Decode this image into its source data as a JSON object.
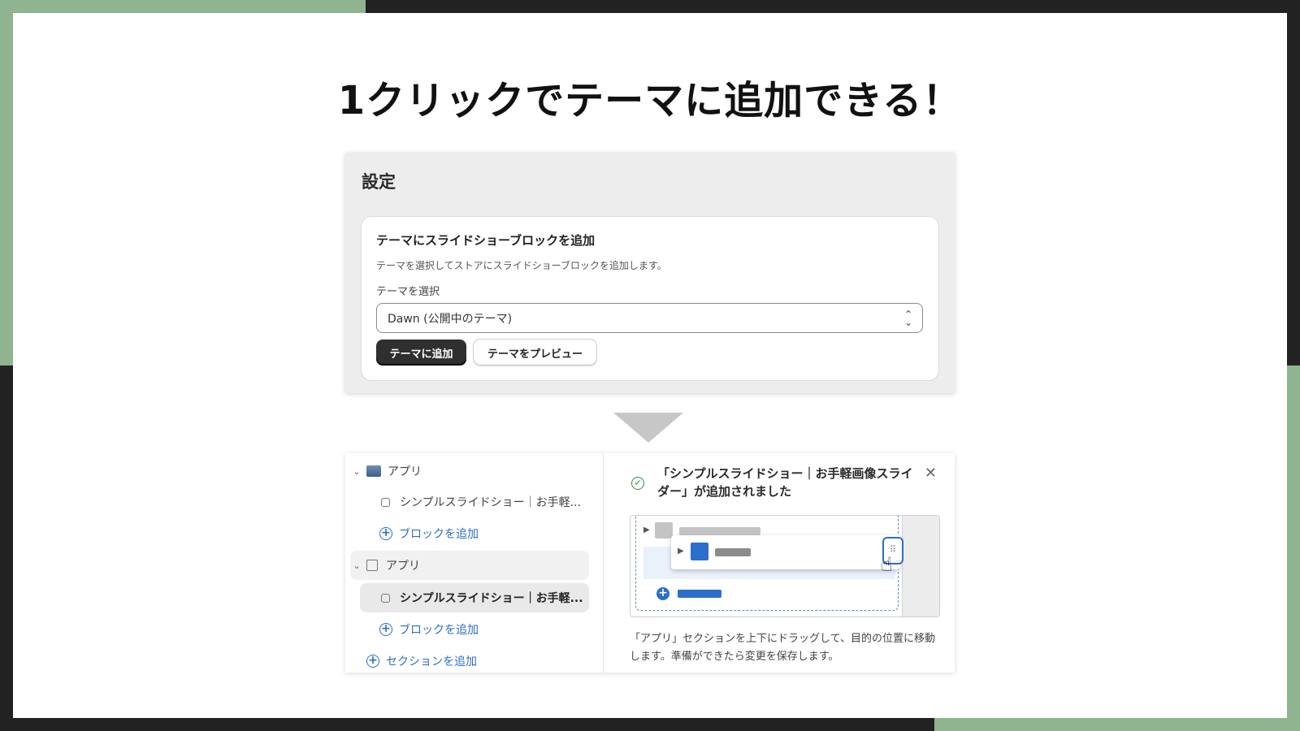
{
  "headline": "1クリックでテーマに追加できる！",
  "settings": {
    "title": "設定",
    "card": {
      "title": "テーマにスライドショーブロックを追加",
      "description": "テーマを選択してストアにスライドショーブロックを追加します。",
      "field_label": "テーマを選択",
      "select_value": "Dawn (公開中のテーマ)",
      "primary_button": "テーマに追加",
      "secondary_button": "テーマをプレビュー"
    }
  },
  "editor": {
    "tree": [
      {
        "label": "アプリ"
      },
      {
        "label": "シンプルスライドショー｜お手軽..."
      },
      {
        "label": "ブロックを追加"
      },
      {
        "label": "アプリ"
      },
      {
        "label": "シンプルスライドショー｜お手軽..."
      },
      {
        "label": "ブロックを追加"
      },
      {
        "label": "セクションを追加"
      }
    ],
    "toast": "「シンプルスライドショー｜お手軽画像スライダー」が追加されました",
    "help_text": "「アプリ」セクションを上下にドラッグして、目的の位置に移動します。準備ができたら変更を保存します。"
  },
  "colors": {
    "accent_green": "#8fb48f",
    "frame_dark": "#222222",
    "link_blue": "#2c6ecb"
  }
}
